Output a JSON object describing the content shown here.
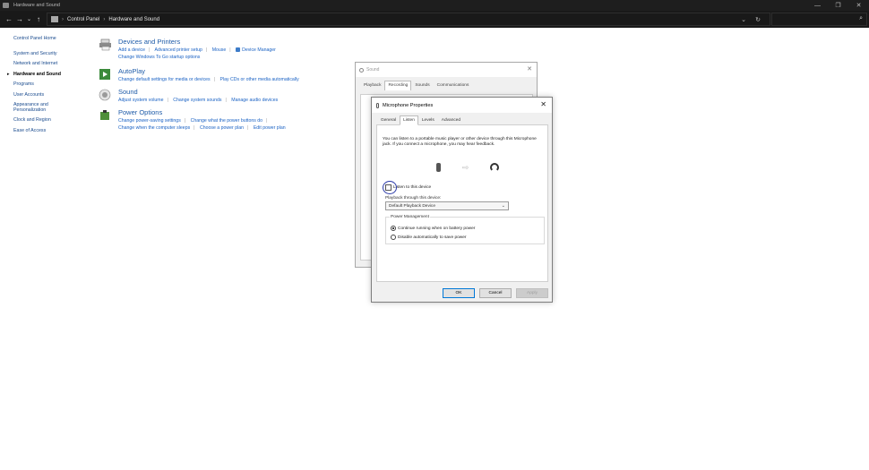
{
  "window": {
    "title": "Hardware and Sound",
    "controls": [
      "—",
      "❐",
      "✕"
    ]
  },
  "address_bar": {
    "back": "←",
    "forward": "→",
    "recent": "⌄",
    "up": "↑",
    "path": [
      "Control Panel",
      "Hardware and Sound"
    ],
    "separator": "›",
    "dropdown": "⌄",
    "refresh": "↻",
    "search_placeholder": "",
    "search_icon": "⌕"
  },
  "left_nav": {
    "home": "Control Panel Home",
    "items": [
      "System and Security",
      "Network and Internet",
      "Hardware and Sound",
      "Programs",
      "User Accounts",
      "Appearance and Personalization",
      "Clock and Region",
      "Ease of Access"
    ],
    "current": "Hardware and Sound"
  },
  "categories": [
    {
      "title": "Devices and Printers",
      "icon": "printer-icon",
      "lines": [
        [
          "Add a device",
          "Advanced printer setup",
          "Mouse",
          "Device Manager"
        ],
        [
          "Change Windows To Go startup options"
        ]
      ]
    },
    {
      "title": "AutoPlay",
      "icon": "autoplay-icon",
      "lines": [
        [
          "Change default settings for media or devices",
          "Play CDs or other media automatically"
        ]
      ]
    },
    {
      "title": "Sound",
      "icon": "speaker-icon",
      "lines": [
        [
          "Adjust system volume",
          "Change system sounds",
          "Manage audio devices"
        ]
      ]
    },
    {
      "title": "Power Options",
      "icon": "power-options-icon",
      "lines": [
        [
          "Change power-saving settings",
          "Change what the power buttons do"
        ],
        [
          "Change when the computer sleeps",
          "Choose a power plan",
          "Edit power plan"
        ]
      ]
    }
  ],
  "sound_dialog": {
    "title": "Sound",
    "close": "✕",
    "tabs": [
      "Playback",
      "Recording",
      "Sounds",
      "Communications"
    ],
    "selected_tab": "Recording"
  },
  "mic_dialog": {
    "title": "Microphone Properties",
    "close": "✕",
    "tabs": [
      "General",
      "Listen",
      "Levels",
      "Advanced"
    ],
    "selected_tab": "Listen",
    "description": "You can listen to a portable music player or other device through this Microphone jack. If you connect a microphone, you may hear feedback.",
    "arrow": "⇨",
    "listen_checkbox_label": "Listen to this device",
    "listen_checked": false,
    "playback_label": "Playback through this device:",
    "playback_value": "Default Playback Device",
    "playback_chevron": "⌄",
    "power_management_label": "Power Management",
    "radio_continue": "Continue running when on battery power",
    "radio_disable": "Disable automatically to save power",
    "radio_selected": "continue",
    "ok": "OK",
    "cancel": "Cancel",
    "apply": "Apply"
  },
  "colors": {
    "titlebar": "#1e1e1e",
    "link": "#1a62c4",
    "category_title": "#1e5ba8",
    "annotation_circle": "#2b3aa8"
  }
}
